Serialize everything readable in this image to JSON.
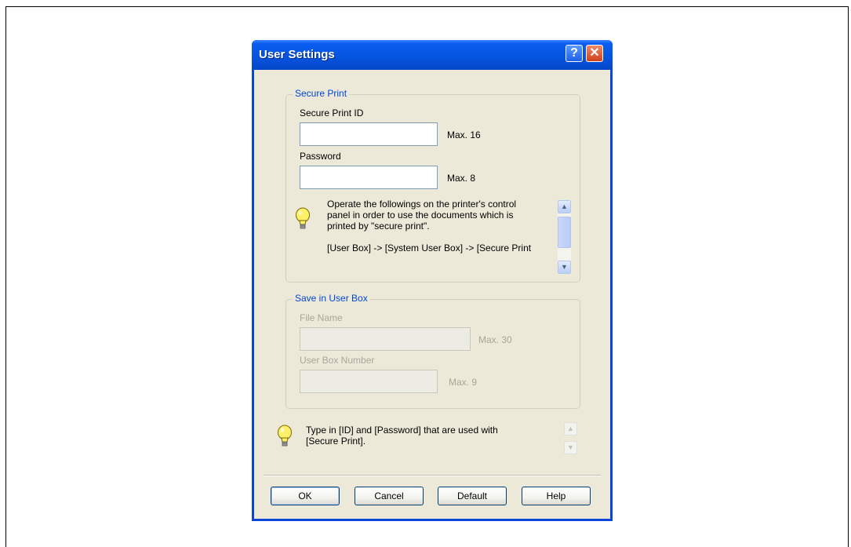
{
  "dialog": {
    "title": "User Settings",
    "help_glyph": "?",
    "close_glyph": "✕"
  },
  "secure_print": {
    "group_label": "Secure Print",
    "id_label": "Secure Print ID",
    "id_value": "",
    "id_max": "Max. 16",
    "password_label": "Password",
    "password_value": "",
    "password_max": "Max. 8",
    "info_text": "Operate the followings on the printer's control\npanel in order to use the documents which is\nprinted by \"secure print\".\n\n[User Box] -> [System User Box] -> [Secure Print"
  },
  "user_box": {
    "group_label": "Save in User Box",
    "file_name_label": "File Name",
    "file_name_value": "",
    "file_name_max": "Max. 30",
    "box_number_label": "User Box Number",
    "box_number_value": "",
    "box_number_max": "Max. 9"
  },
  "hint": {
    "text": "Type in [ID] and [Password] that are used with\n[Secure Print]."
  },
  "buttons": {
    "ok": "OK",
    "cancel": "Cancel",
    "default": "Default",
    "help": "Help"
  },
  "icons": {
    "bulb": "lightbulb-icon",
    "up": "scroll-up-arrow-icon",
    "down": "scroll-down-arrow-icon"
  },
  "colors": {
    "title_bar": "#0a5df0",
    "dialog_face": "#ece9d8",
    "group_title": "#0046d5",
    "disabled_text": "#a7a69a"
  }
}
